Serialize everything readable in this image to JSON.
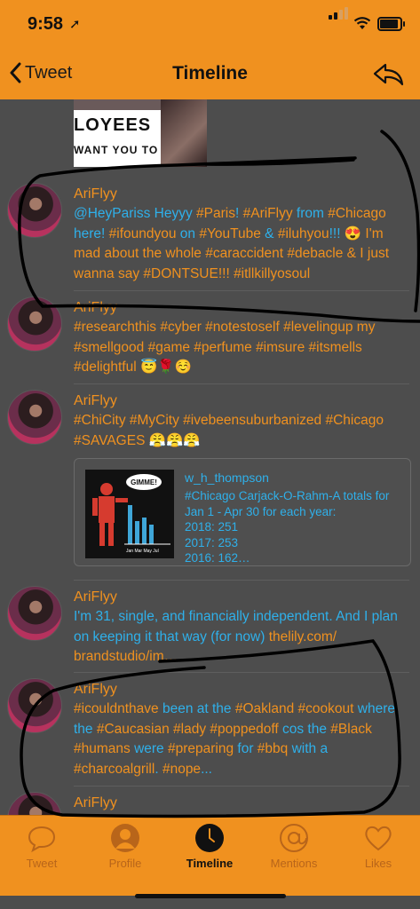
{
  "status_bar": {
    "time": "9:58",
    "location_glyph": "➚"
  },
  "nav": {
    "back_label": "Tweet",
    "title": "Timeline"
  },
  "top_image": {
    "line1": "LOYEES",
    "line2": "WANT YOU TO KN"
  },
  "tweets": [
    {
      "author": "AriFlyy",
      "timestamp": "",
      "segments": [
        {
          "t": "@HeyPariss ",
          "c": "blue"
        },
        {
          "t": "Heyyy ",
          "c": "blue"
        },
        {
          "t": "#Paris",
          "c": "orange"
        },
        {
          "t": "! ",
          "c": "blue"
        },
        {
          "t": "#AriFlyy",
          "c": "orange"
        },
        {
          "t": " from ",
          "c": "blue"
        },
        {
          "t": "#Chicago",
          "c": "orange"
        },
        {
          "t": " here! ",
          "c": "blue"
        },
        {
          "t": "#ifoundyou",
          "c": "orange"
        },
        {
          "t": " on ",
          "c": "blue"
        },
        {
          "t": "#YouTube",
          "c": "orange"
        },
        {
          "t": " & ",
          "c": "blue"
        },
        {
          "t": "#iluhyou",
          "c": "orange"
        },
        {
          "t": "!!! 😍 ",
          "c": "blue"
        },
        {
          "t": "I'm mad about the whole ",
          "c": "orange"
        },
        {
          "t": "#caraccident",
          "c": "orange"
        },
        {
          "t": " ",
          "c": "orange"
        },
        {
          "t": "#debacle",
          "c": "orange"
        },
        {
          "t": " & I just wanna say ",
          "c": "orange"
        },
        {
          "t": "#DONTSUE",
          "c": "orange"
        },
        {
          "t": "!!! ",
          "c": "orange"
        },
        {
          "t": "#itllkillyosoul",
          "c": "orange"
        }
      ]
    },
    {
      "author": "AriFlyy",
      "timestamp": "",
      "segments": [
        {
          "t": "#researchthis #cyber #notestoself #levelingup my #smellgood #game #perfume #imsure #itsmells #delightful 😇🌹☺️",
          "c": "orange"
        }
      ]
    },
    {
      "author": "AriFlyy",
      "timestamp": "",
      "segments": [
        {
          "t": "#ChiCity #MyCity #ivebeensuburbanized #Chicago #SAVAGES 😤😤😤",
          "c": "orange"
        }
      ]
    },
    {
      "author": "AriFlyy",
      "timestamp": "",
      "segments": [
        {
          "t": "I'm 31, single, and financially independent. And I plan on keeping it that way (for now) ",
          "c": "blue"
        },
        {
          "t": "thelily.com/ brandstudio/im…",
          "c": "orange"
        }
      ]
    },
    {
      "author": "AriFlyy",
      "timestamp": "",
      "segments": [
        {
          "t": "#icouldnthave",
          "c": "orange"
        },
        {
          "t": " been at the ",
          "c": "blue"
        },
        {
          "t": "#Oakland",
          "c": "orange"
        },
        {
          "t": " ",
          "c": "blue"
        },
        {
          "t": "#cookout",
          "c": "orange"
        },
        {
          "t": " where the ",
          "c": "blue"
        },
        {
          "t": "#Caucasian",
          "c": "orange"
        },
        {
          "t": " ",
          "c": "blue"
        },
        {
          "t": "#lady",
          "c": "orange"
        },
        {
          "t": " ",
          "c": "blue"
        },
        {
          "t": "#poppedoff",
          "c": "orange"
        },
        {
          "t": " cos the ",
          "c": "blue"
        },
        {
          "t": "#Black",
          "c": "orange"
        },
        {
          "t": " ",
          "c": "blue"
        },
        {
          "t": "#humans",
          "c": "orange"
        },
        {
          "t": " were ",
          "c": "blue"
        },
        {
          "t": "#preparing",
          "c": "orange"
        },
        {
          "t": " for ",
          "c": "blue"
        },
        {
          "t": "#bbq",
          "c": "orange"
        },
        {
          "t": " with a ",
          "c": "blue"
        },
        {
          "t": "#charcoalgrill",
          "c": "orange"
        },
        {
          "t": ". ",
          "c": "blue"
        },
        {
          "t": "#nope",
          "c": "orange"
        },
        {
          "t": "...",
          "c": "blue"
        }
      ]
    },
    {
      "author": "AriFlyy",
      "timestamp": "",
      "segments": []
    }
  ],
  "quoted_card": {
    "name": "w_h_thompson",
    "lines": [
      "#Chicago Carjack-O-Rahm-A totals for Jan 1 - Apr 30 for each year:",
      "2018: 251",
      "2017: 253",
      "2016: 162…"
    ],
    "thumb_bubble": "GIMME!",
    "thumb_months": "Jan Mar May Jul"
  },
  "tabs": [
    {
      "label": "Tweet",
      "icon": "speech-bubble-icon"
    },
    {
      "label": "Profile",
      "icon": "person-icon"
    },
    {
      "label": "Timeline",
      "icon": "clock-icon",
      "active": true
    },
    {
      "label": "Mentions",
      "icon": "at-sign-icon"
    },
    {
      "label": "Likes",
      "icon": "heart-icon"
    }
  ],
  "colors": {
    "accent": "#f0911f",
    "link": "#2fb0ea",
    "background": "#4d4d4d"
  }
}
